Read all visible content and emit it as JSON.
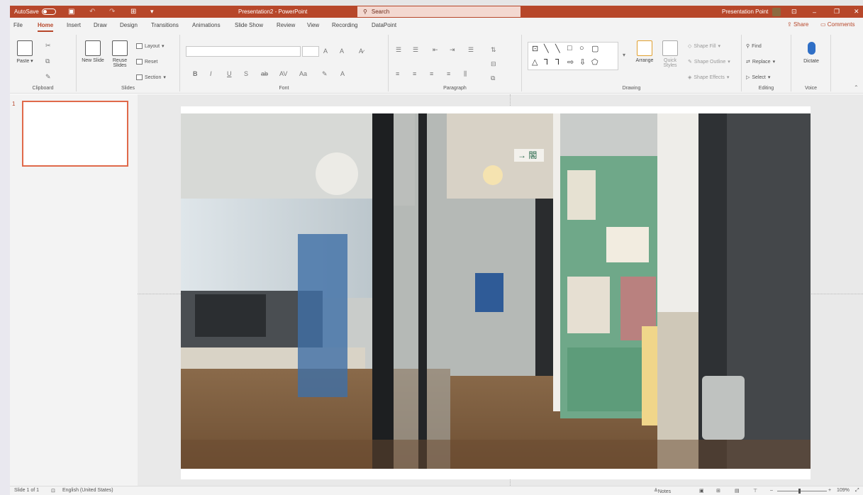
{
  "titlebar": {
    "autosave": "AutoSave",
    "autosave_state": "Off",
    "doc_title": "Presentation2 - PowerPoint",
    "search_placeholder": "Search",
    "user_name": "Presentation Point"
  },
  "tabs": [
    "File",
    "Home",
    "Insert",
    "Draw",
    "Design",
    "Transitions",
    "Animations",
    "Slide Show",
    "Review",
    "View",
    "Recording",
    "DataPoint"
  ],
  "active_tab": "Home",
  "tab_actions": {
    "share": "Share",
    "comments": "Comments"
  },
  "ribbon": {
    "clipboard": {
      "paste": "Paste",
      "label": "Clipboard"
    },
    "slides": {
      "new_slide": "New Slide",
      "reuse_slides": "Reuse Slides",
      "layout": "Layout",
      "reset": "Reset",
      "section": "Section",
      "label": "Slides"
    },
    "font": {
      "label": "Font"
    },
    "paragraph": {
      "label": "Paragraph"
    },
    "drawing": {
      "arrange": "Arrange",
      "quick_styles": "Quick Styles",
      "shape_fill": "Shape Fill",
      "shape_outline": "Shape Outline",
      "shape_effects": "Shape Effects",
      "label": "Drawing"
    },
    "editing": {
      "find": "Find",
      "replace": "Replace",
      "select": "Select",
      "label": "Editing"
    },
    "voice": {
      "dictate": "Dictate",
      "label": "Voice"
    }
  },
  "thumbnails": {
    "slide_number": "1"
  },
  "status": {
    "slide_info": "Slide 1 of 1",
    "language": "English (United States)",
    "notes": "Notes",
    "zoom": "109%"
  },
  "colors": {
    "accent": "#b7472a",
    "thumb_border": "#e0694a"
  }
}
